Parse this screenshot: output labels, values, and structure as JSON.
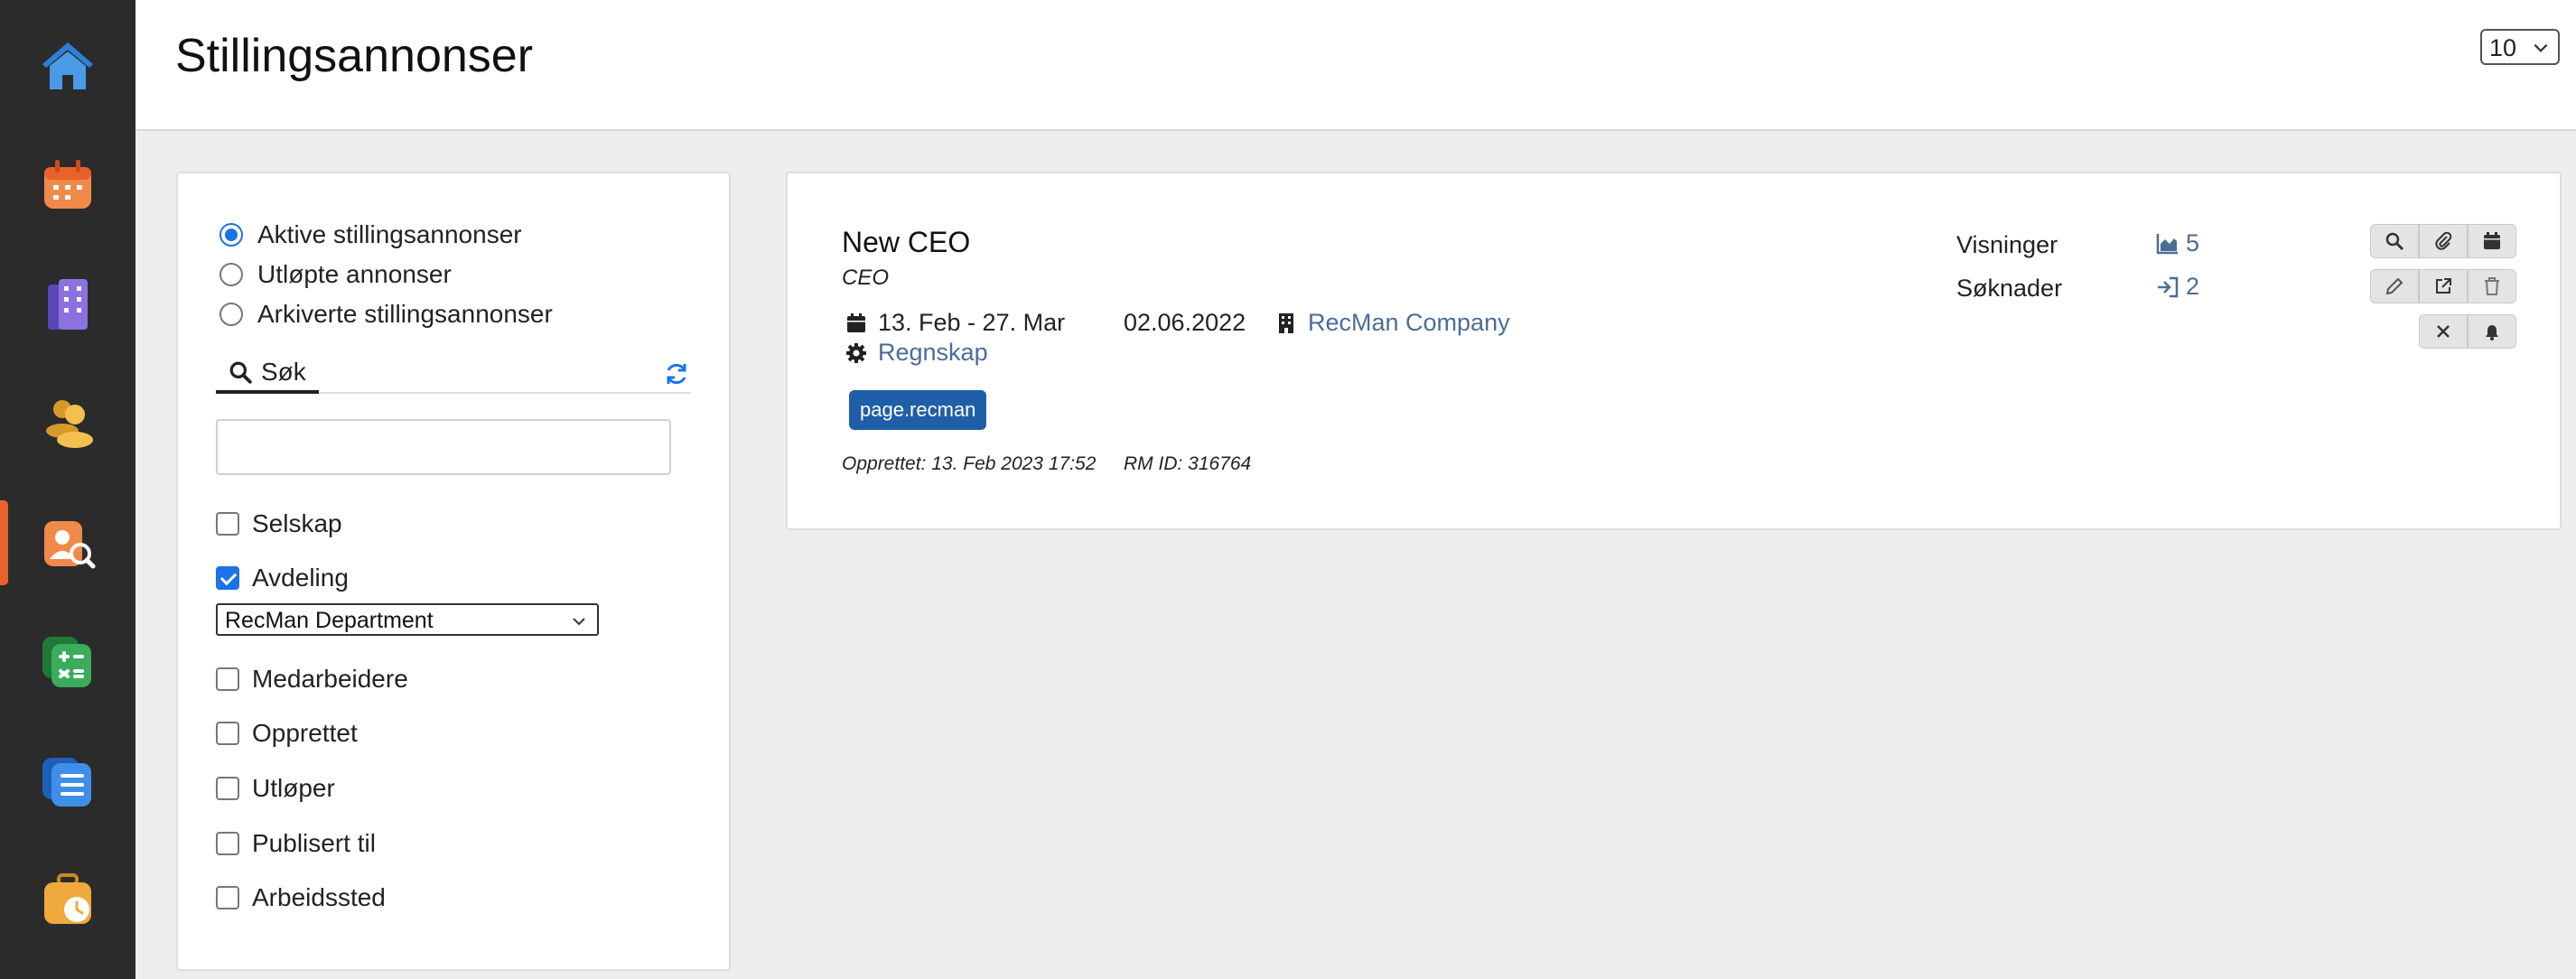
{
  "sidebar": {
    "items": [
      {
        "icon": "home-icon",
        "color": "#2f7fd8"
      },
      {
        "icon": "calendar-icon",
        "color": "#e8632c"
      },
      {
        "icon": "building-icon",
        "color": "#7a5ed6"
      },
      {
        "icon": "people-icon",
        "color": "#e8b23c"
      },
      {
        "icon": "candidate-search-icon",
        "color": "#e8632c",
        "active": true
      },
      {
        "icon": "calculator-icon",
        "color": "#2f9b4a"
      },
      {
        "icon": "document-list-icon",
        "color": "#2f7fd8"
      },
      {
        "icon": "briefcase-clock-icon",
        "color": "#e8a52c"
      }
    ]
  },
  "header": {
    "title": "Stillingsannonser",
    "per_page": "10"
  },
  "filters": {
    "status_options": [
      {
        "label": "Aktive stillingsannonser",
        "selected": true
      },
      {
        "label": "Utløpte annonser",
        "selected": false
      },
      {
        "label": "Arkiverte stillingsannonser",
        "selected": false
      }
    ],
    "search_tab_label": "Søk",
    "search_value": "",
    "checks": [
      {
        "label": "Selskap",
        "checked": false
      },
      {
        "label": "Avdeling",
        "checked": true
      },
      {
        "label": "Medarbeidere",
        "checked": false
      },
      {
        "label": "Opprettet",
        "checked": false
      },
      {
        "label": "Utløper",
        "checked": false
      },
      {
        "label": "Publisert til",
        "checked": false
      },
      {
        "label": "Arbeidssted",
        "checked": false
      }
    ],
    "department_selected": "RecMan Department"
  },
  "job": {
    "title": "New CEO",
    "subtitle": "CEO",
    "date_range": "13. Feb - 27. Mar",
    "date": "02.06.2022",
    "company": "RecMan Company",
    "category": "Regnskap",
    "tag": "page.recman",
    "created": "Opprettet: 13. Feb 2023 17:52",
    "rm_id": "RM ID: 316764",
    "stats": {
      "views_label": "Visninger",
      "views_value": "5",
      "applications_label": "Søknader",
      "applications_value": "2"
    }
  },
  "colors": {
    "accent": "#1a73e8",
    "link": "#4a6d96",
    "tag_bg": "#1f5fa8",
    "sidebar_bg": "#2b2b2b",
    "active_marker": "#e8632c"
  }
}
